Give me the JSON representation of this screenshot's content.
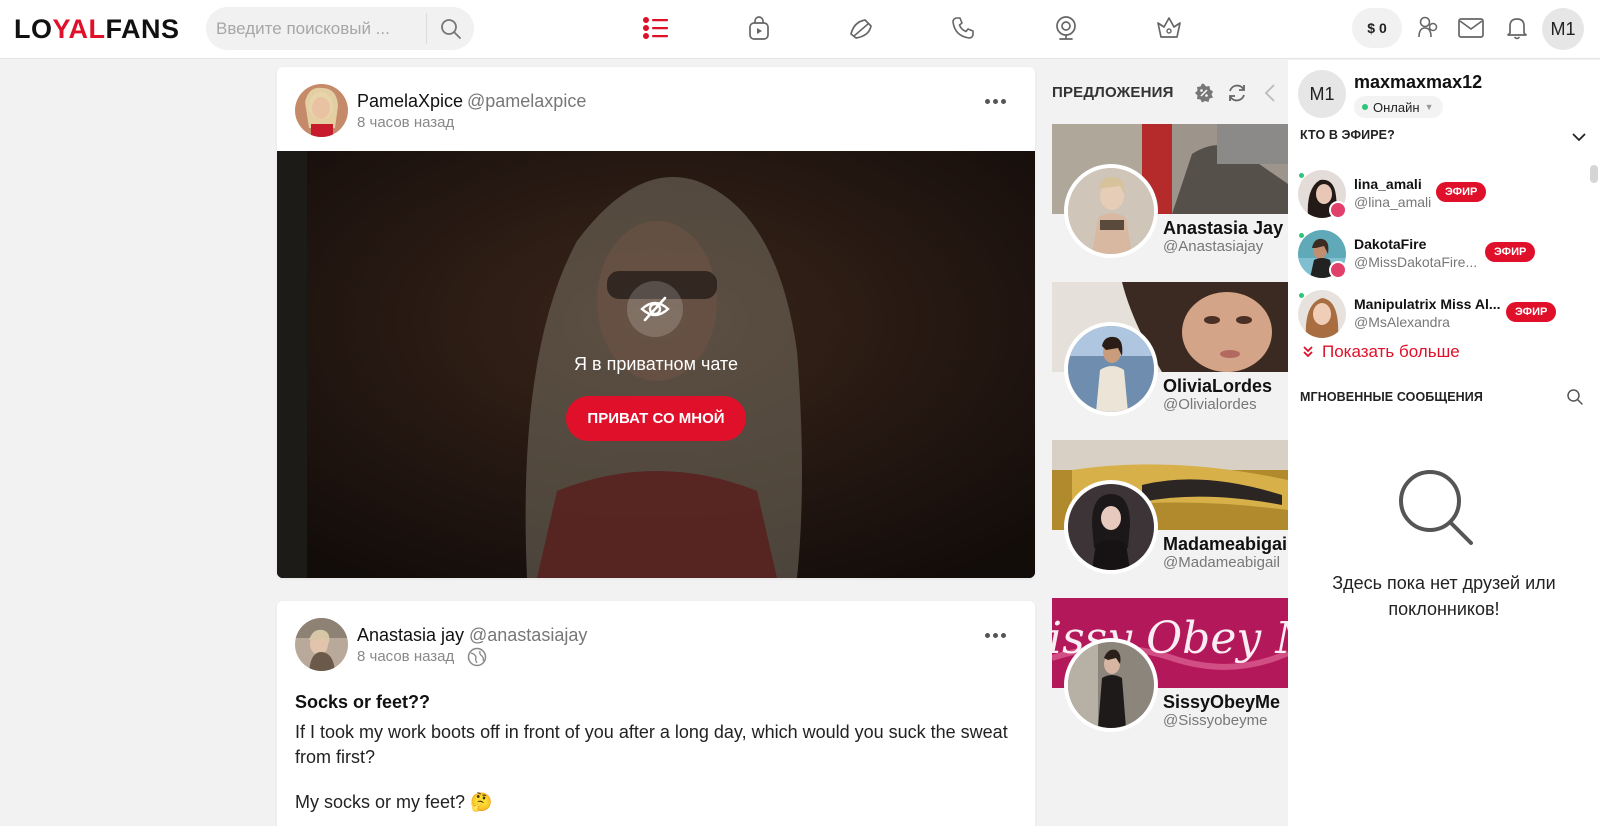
{
  "topbar": {
    "logo_part1": "LO",
    "logo_part2": "YAL",
    "logo_part3": "FANS",
    "search_placeholder": "Введите поисковый ...",
    "balance": "$ 0",
    "avatar_initials": "M1",
    "nav_icons": [
      "feed-list-icon",
      "shopping-bag-icon",
      "tip-icon",
      "phone-icon",
      "webcam-icon",
      "crown-icon"
    ],
    "right_icons": [
      "friends-icon",
      "mail-icon",
      "bell-icon"
    ],
    "accent": "#e0102a"
  },
  "feed": {
    "posts": [
      {
        "name": "PamelaXpice",
        "handle": "@pamelaxpice",
        "time": "8 часов назад",
        "private_text": "Я в приватном чате",
        "private_button": "ПРИВАТ СО МНОЙ"
      },
      {
        "name": "Anastasia jay",
        "handle": "@anastasiajay",
        "time": "8 часов назад",
        "title": "Socks or feet??",
        "body": "If I took my work boots off in front of you after a long day, which would you suck the sweat from first?",
        "body2": "My socks or my feet? 🤔"
      }
    ]
  },
  "suggestions": {
    "title": "ПРЕДЛОЖЕНИЯ",
    "cards": [
      {
        "name": "Anastasia Jay",
        "handle": "@Anastasiajay"
      },
      {
        "name": "OliviaLordes",
        "handle": "@Olivialordes"
      },
      {
        "name": "Madameabigail",
        "handle": "@Madameabigail"
      },
      {
        "name": "SissyObeyMe",
        "handle": "@Sissyobeyme",
        "cover_text": "issy Obey M"
      }
    ]
  },
  "right_panel": {
    "user": {
      "initials": "M1",
      "name": "maxmaxmax12",
      "status": "Онлайн"
    },
    "live_title": "КТО В ЭФИРЕ?",
    "live": [
      {
        "name": "lina_amali",
        "handle": "@lina_amali",
        "badge": "ЭФИР"
      },
      {
        "name": "DakotaFire",
        "handle": "@MissDakotaFire...",
        "badge": "ЭФИР"
      },
      {
        "name": "Manipulatrix Miss Al...",
        "handle": "@MsAlexandra",
        "badge": "ЭФИР"
      }
    ],
    "show_more": "Показать больше",
    "messages_title": "МГНОВЕННЫЕ СООБЩЕНИЯ",
    "empty_text": "Здесь пока нет друзей или поклонников!"
  }
}
